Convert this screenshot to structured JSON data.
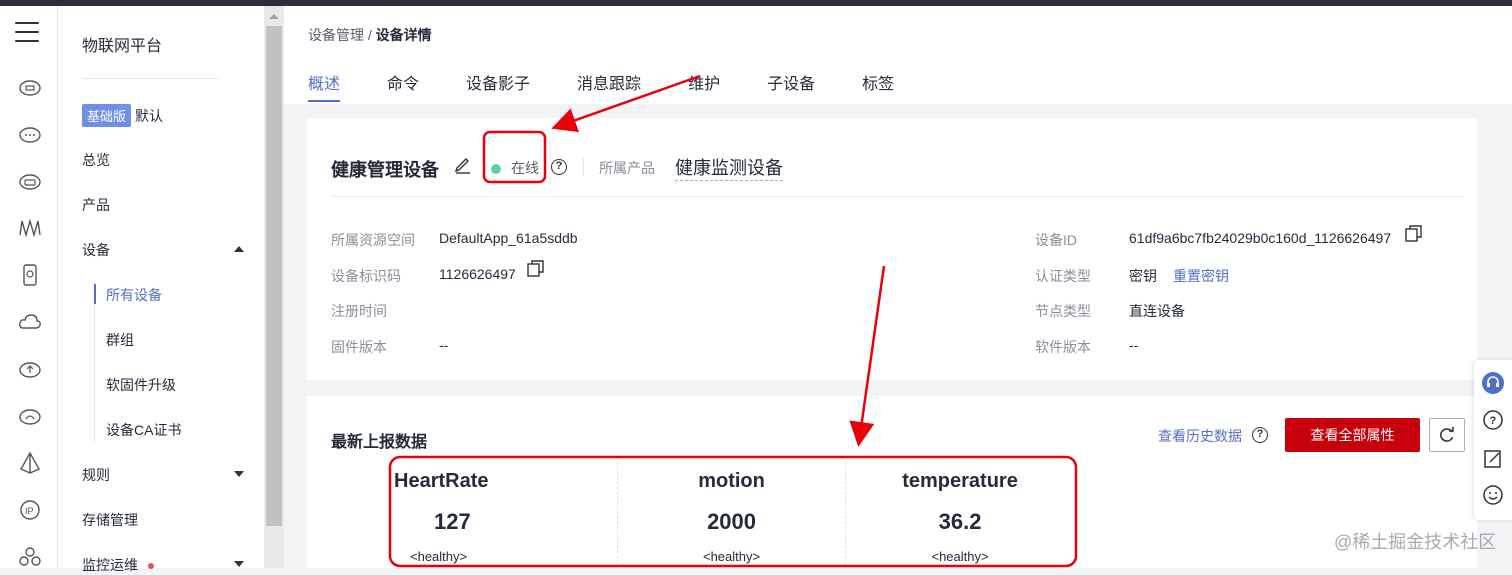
{
  "nav": {
    "platform_title": "物联网平台",
    "edition_badge": "基础版",
    "edition_name": "默认",
    "items": {
      "overview": "总览",
      "product": "产品",
      "device": "设备",
      "all_devices": "所有设备",
      "group": "群组",
      "firmware": "软固件升级",
      "ca_cert": "设备CA证书",
      "rules": "规则",
      "storage": "存储管理",
      "monitor": "监控运维"
    }
  },
  "breadcrumb": {
    "parent": "设备管理",
    "separator": " / ",
    "current": "设备详情"
  },
  "tabs": [
    "概述",
    "命令",
    "设备影子",
    "消息跟踪",
    "维护",
    "子设备",
    "标签"
  ],
  "device": {
    "name": "健康管理设备",
    "status": "在线",
    "product_label": "所属产品",
    "product_name": "健康监测设备",
    "fields": {
      "resource_space_label": "所属资源空间",
      "resource_space_value": "DefaultApp_61a5sddb",
      "identifier_label": "设备标识码",
      "identifier_value": "1126626497",
      "register_time_label": "注册时间",
      "firmware_label": "固件版本",
      "firmware_value": "--",
      "device_id_label": "设备ID",
      "device_id_value": "61df9a6bc7fb24029b0c160d_1126626497",
      "auth_type_label": "认证类型",
      "auth_type_value": "密钥",
      "reset_key_link": "重置密钥",
      "node_type_label": "节点类型",
      "node_type_value": "直连设备",
      "software_label": "软件版本",
      "software_value": "--"
    }
  },
  "latest": {
    "title": "最新上报数据",
    "history_link": "查看历史数据",
    "view_all_button": "查看全部属性",
    "metrics": [
      {
        "name": "HeartRate",
        "value": "127",
        "status": "<healthy>"
      },
      {
        "name": "motion",
        "value": "2000",
        "status": "<healthy>"
      },
      {
        "name": "temperature",
        "value": "36.2",
        "status": "<healthy>"
      }
    ]
  },
  "watermark": "@稀土掘金技术社区",
  "colors": {
    "accent": "#526ecc",
    "primary_button": "#c7000b",
    "online_dot": "#5fcfa6",
    "annotation": "#e8000b"
  }
}
